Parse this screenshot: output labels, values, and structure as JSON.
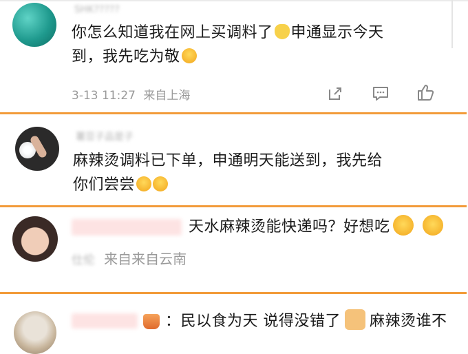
{
  "colors": {
    "divider": "#f29b3a",
    "meta": "#9a9a9a",
    "text": "#1a1a1a"
  },
  "comments": [
    {
      "username": "SHK?????",
      "text_line1": "你怎么知道我在网上买调料了",
      "text_line1b": "申通显示今天",
      "text_line2": "到，我先吃为敬",
      "time": "3-13 11:27",
      "location": "来自上海",
      "icons": [
        "share-icon",
        "comment-icon",
        "like-icon"
      ]
    },
    {
      "username": "薯豆子品是子",
      "text_line1": "麻辣烫调料已下单，申通明天能送到，我先给",
      "text_line2": "你们尝尝"
    },
    {
      "username": "",
      "text": "天水麻辣烫能快递吗？好想吃",
      "meta_blur": "仕伦",
      "location": "来自来自云南"
    },
    {
      "username": "",
      "text_a": "：民以食为天 说得没错了",
      "text_b": "麻辣烫谁不"
    }
  ]
}
